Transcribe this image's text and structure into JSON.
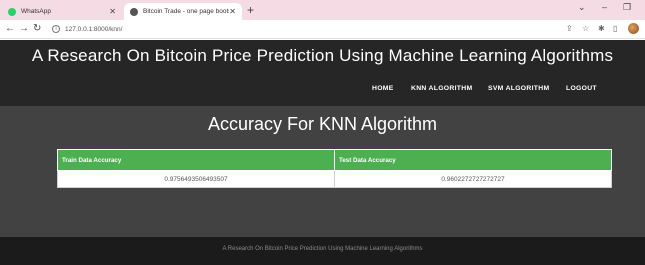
{
  "browser": {
    "tabs": [
      {
        "title": "WhatsApp",
        "icon": "whatsapp-icon",
        "active": false
      },
      {
        "title": "Bitcoin Trade - one page bootstr",
        "icon": "globe-icon",
        "active": true
      }
    ],
    "url": "127.0.0.1:8000/knn/"
  },
  "header": {
    "title": "A Research On Bitcoin Price Prediction Using Machine Learning Algorithms",
    "nav": [
      "HOME",
      "KNN ALGORITHM",
      "SVM ALGORITHM",
      "LOGOUT"
    ]
  },
  "main": {
    "heading": "Accuracy For KNN Algorithm",
    "table": {
      "headers": [
        "Train Data Accuracy",
        "Test Data Accuracy"
      ],
      "row": [
        "0.9756493506493507",
        "0.9602272727272727"
      ]
    }
  },
  "footer": {
    "text": "A Research On Bitcoin Price Prediction Using Machine Learning Algorithms"
  },
  "colors": {
    "header_bg": "#262626",
    "main_bg": "#424242",
    "footer_bg": "#1b1b1b",
    "table_header": "#4caf50"
  }
}
